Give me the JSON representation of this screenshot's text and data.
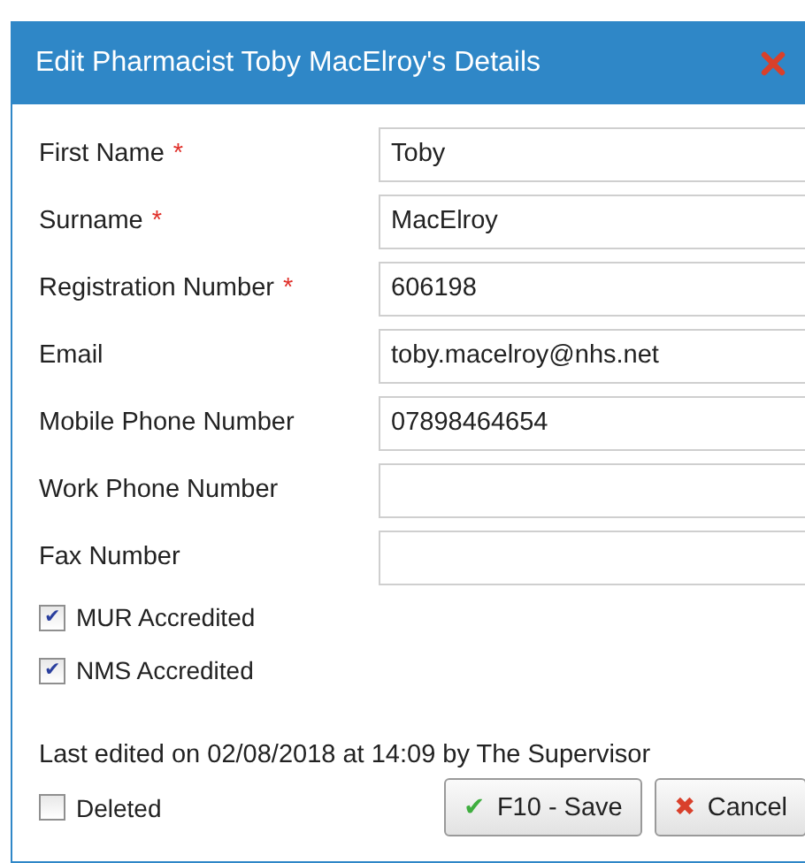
{
  "window": {
    "title": "Edit Pharmacist Toby MacElroy's Details"
  },
  "fields": [
    {
      "label": "First Name",
      "required": true,
      "value": "Toby"
    },
    {
      "label": "Surname",
      "required": true,
      "value": "MacElroy"
    },
    {
      "label": "Registration Number",
      "required": true,
      "value": "606198"
    },
    {
      "label": "Email",
      "required": false,
      "value": "toby.macelroy@nhs.net"
    },
    {
      "label": "Mobile Phone Number",
      "required": false,
      "value": "07898464654"
    },
    {
      "label": "Work Phone Number",
      "required": false
    },
    {
      "label": "Fax Number",
      "required": false
    }
  ],
  "required_mark": "*",
  "checkboxes": [
    {
      "label": "MUR Accredited",
      "checked": true
    },
    {
      "label": "NMS Accredited",
      "checked": true
    }
  ],
  "last_edited": "Last edited on 02/08/2018 at 14:09 by The Supervisor",
  "deleted": {
    "label": "Deleted",
    "checked": false
  },
  "buttons": [
    {
      "kind": "save",
      "icon": "✔",
      "label": "F10 - Save"
    },
    {
      "kind": "cancel",
      "icon": "✖",
      "label": "Cancel"
    }
  ]
}
